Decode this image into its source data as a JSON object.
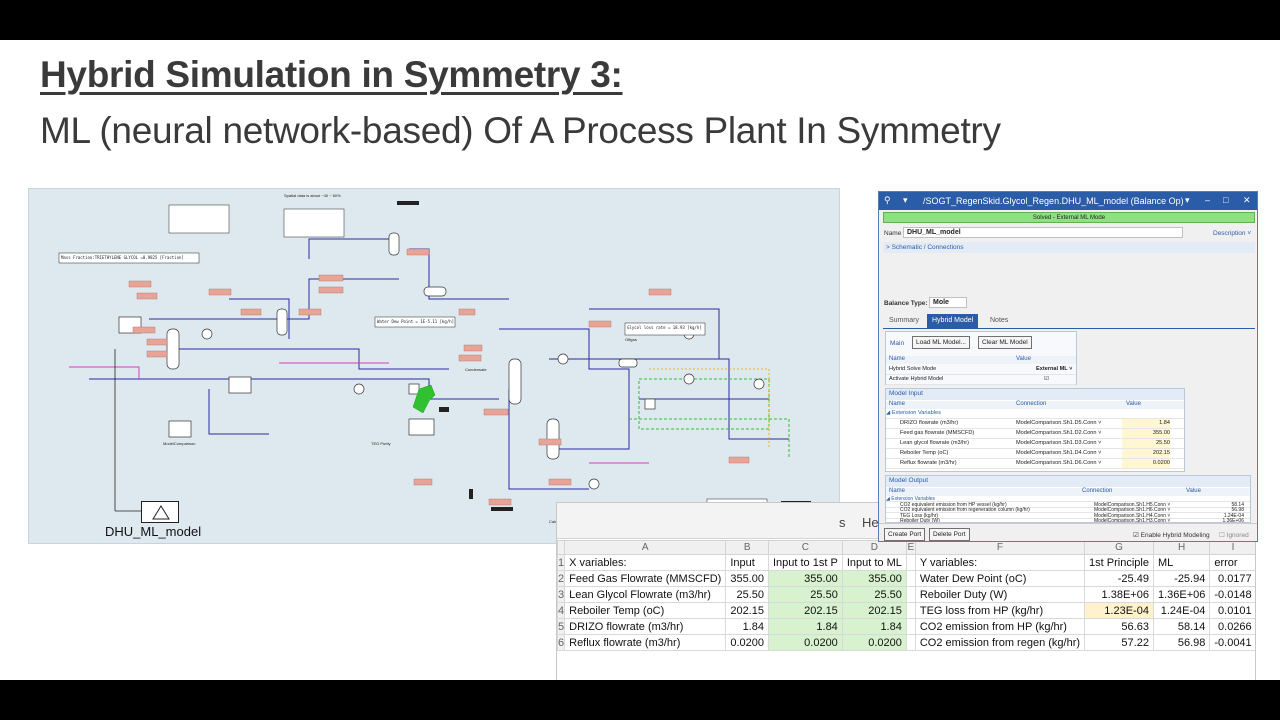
{
  "slide": {
    "title": "Hybrid Simulation in Symmetry 3:",
    "subtitle": "ML (neural network-based) Of A Process Plant In Symmetry"
  },
  "pfd": {
    "block_label": "DHU_ML_model",
    "note_top": "Spatial data is about ~40 ~ 60%",
    "stream_box_1": "Mass Fraction:TRIETHYLENE GLYCOL =0.9825 [Fraction]",
    "note_water": "Water Dew Point = 1E-5.11 [kg/h]",
    "note_glycol": "Glycol loss rate = 18.93 [kg/h]",
    "teg_text": "TEG Purity",
    "model_comp": "ModelComparison",
    "note_mlcomp": "Calculated ML using MetMan data is very low compared to design. ...",
    "note_off": "Offgas",
    "note_cond": "Condensate"
  },
  "dialog": {
    "title": "/SOGT_RegenSkid.Glycol_Regen.DHU_ML_model (Balance Op)",
    "status": "Solved - External ML Mode",
    "name_label": "Name",
    "name_value": "DHU_ML_model",
    "description_link": "Description ˅",
    "schematic_link": "> Schematic / Connections",
    "balance_type_label": "Balance Type:",
    "balance_type_value": "Mole",
    "tabs": [
      "Summary",
      "Hybrid Model",
      "Notes"
    ],
    "main_label": "Main",
    "load_button": "Load ML Model...",
    "clear_button": "Clear ML Model",
    "settings_header": [
      "Name",
      "Value"
    ],
    "settings": [
      {
        "name": "Hybrid Solve Mode",
        "value": "External ML ˅"
      },
      {
        "name": "Activate Hybrid Model",
        "value": "☑"
      }
    ],
    "input_title": "Model Input",
    "input_header": [
      "Name",
      "Connection",
      "Value"
    ],
    "input_group": "◢ Extension Variables",
    "inputs": [
      {
        "name": "DRIZO flowrate (m3/hr)",
        "conn": "ModelComparison.Sh1.D5.Conn ˅",
        "value": "1.84"
      },
      {
        "name": "Feed gas flowrate (MMSCFD)",
        "conn": "ModelComparison.Sh1.D2.Conn ˅",
        "value": "355.00"
      },
      {
        "name": "Lean glycol flowrate (m3/hr)",
        "conn": "ModelComparison.Sh1.D3.Conn ˅",
        "value": "25.50"
      },
      {
        "name": "Reboiler Temp (oC)",
        "conn": "ModelComparison.Sh1.D4.Conn ˅",
        "value": "202.15"
      },
      {
        "name": "Reflux flowrate (m3/hr)",
        "conn": "ModelComparison.Sh1.D6.Conn ˅",
        "value": "0.0200"
      }
    ],
    "output_title": "Model Output",
    "output_header": [
      "Name",
      "Connection",
      "Value"
    ],
    "output_group": "◢ Extension Variables",
    "outputs": [
      {
        "name": "CO2 equivalent emission from HP vessel (kg/hr)",
        "conn": "ModelComparison.Sh1.H5.Conn ˅",
        "value": "58.14"
      },
      {
        "name": "CO2 equivalent emission from regeneration column (kg/hr)",
        "conn": "ModelComparison.Sh1.H6.Conn ˅",
        "value": "56.98"
      },
      {
        "name": "TEG Loss (kg/hr)",
        "conn": "ModelComparison.Sh1.H4.Conn ˅",
        "value": "1.24E-04"
      },
      {
        "name": "Reboiler Duty (W)",
        "conn": "ModelComparison.Sh1.H3.Conn ˅",
        "value": "1.36E+06"
      },
      {
        "name": "Water Dew Point (oC)",
        "conn": "ModelComparison.Sh1.H2.Conn ˅",
        "value": "-25.94"
      }
    ],
    "create_port": "Create Port",
    "delete_port": "Delete Port",
    "enable_label": "☑ Enable Hybrid Modeling",
    "ignored_label": "☐ Ignored"
  },
  "excel": {
    "tabs": [
      "s",
      "Hel"
    ],
    "col_letters": [
      "",
      "A",
      "B",
      "C",
      "D",
      "E",
      "F",
      "G",
      "H",
      "I"
    ],
    "header_row": [
      "1",
      "X variables:",
      "Input",
      "Input to 1st P",
      "Input to ML",
      "",
      "Y variables:",
      "1st Principle",
      "ML",
      "error"
    ],
    "rows": [
      [
        "2",
        "Feed Gas Flowrate (MMSCFD)",
        "355.00",
        "355.00",
        "355.00",
        "",
        "Water Dew Point (oC)",
        "-25.49",
        "-25.94",
        "0.0177"
      ],
      [
        "3",
        "Lean Glycol Flowrate (m3/hr)",
        "25.50",
        "25.50",
        "25.50",
        "",
        "Reboiler Duty (W)",
        "1.38E+06",
        "1.36E+06",
        "-0.0148"
      ],
      [
        "4",
        "Reboiler Temp (oC)",
        "202.15",
        "202.15",
        "202.15",
        "",
        "TEG loss from HP (kg/hr)",
        "1.23E-04",
        "1.24E-04",
        "0.0101"
      ],
      [
        "5",
        "DRIZO flowrate (m3/hr)",
        "1.84",
        "1.84",
        "1.84",
        "",
        "CO2 emission from HP (kg/hr)",
        "56.63",
        "58.14",
        "0.0266"
      ],
      [
        "6",
        "Reflux flowrate (m3/hr)",
        "0.0200",
        "0.0200",
        "0.0200",
        "",
        "CO2 emission from regen (kg/hr)",
        "57.22",
        "56.98",
        "-0.0041"
      ]
    ]
  },
  "colors": {
    "accent": "#2b5ca8",
    "status_green": "#8fe080",
    "cell_green": "#d8f2d0",
    "cell_yellow": "#fff2cc"
  }
}
